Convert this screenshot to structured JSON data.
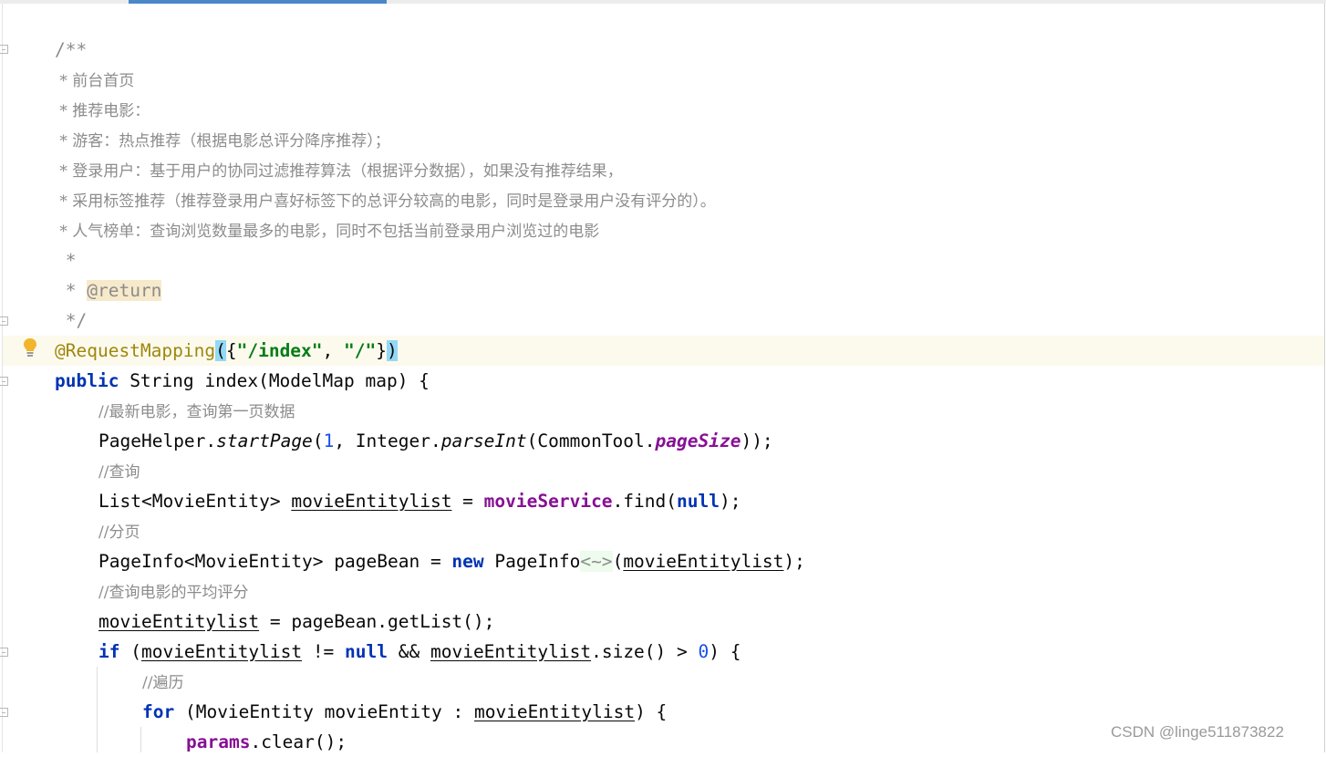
{
  "editor": {
    "doc_lines": [
      "/**",
      " * 前台首页",
      " * 推荐电影：",
      " * 游客：热点推荐（根据电影总评分降序推荐）；",
      " * 登录用户：基于用户的协同过滤推荐算法（根据评分数据），如果没有推荐结果，",
      " * 采用标签推荐（推荐登录用户喜好标签下的总评分较高的电影，同时是登录用户没有评分的）。",
      " * 人气榜单：查询浏览数量最多的电影，同时不包括当前登录用户浏览过的电影",
      " *",
      " * ",
      " */"
    ],
    "doc_tag": "@return",
    "annotation": "@RequestMapping",
    "mapping_path_1": "\"/index\"",
    "mapping_path_2": "\"/\"",
    "kw_public": "public",
    "method_sig": " String index(ModelMap map) {",
    "comment_latest": "//最新电影，查询第一页数据",
    "l_pagehelper": "PageHelper.",
    "l_startpage": "startPage",
    "l_one": "1",
    "l_integer": ", Integer.",
    "l_parseint": "parseInt",
    "l_commontool": "(CommonTool.",
    "l_pagesize": "pageSize",
    "l_close": "));",
    "comment_query": "//查询",
    "l_list_type": "List<MovieEntity> ",
    "var_list": "movieEntitylist",
    "l_eq": " = ",
    "field_service": "movieService",
    "l_find": ".find(",
    "kw_null": "null",
    "l_find_close": ");",
    "comment_page": "//分页",
    "l_pageinfo": "PageInfo<MovieEntity> pageBean = ",
    "kw_new": "new",
    "l_pageinfo2": " PageInfo",
    "diamond": "<~>",
    "l_paren": "(",
    "comment_avg": "//查询电影的平均评分",
    "l_getlist": " = pageBean.getList();",
    "kw_if": "if",
    "l_if_open": " (",
    "l_neq": " != ",
    "l_and": " && ",
    "l_size": ".size() > ",
    "l_zero": "0",
    "l_brace": ") {",
    "comment_iterate": "//遍历",
    "kw_for": "for",
    "l_for_mid": " (MovieEntity movieEntity : ",
    "field_params": "params",
    "l_clear": ".clear();"
  },
  "watermark": "CSDN @linge511873822"
}
